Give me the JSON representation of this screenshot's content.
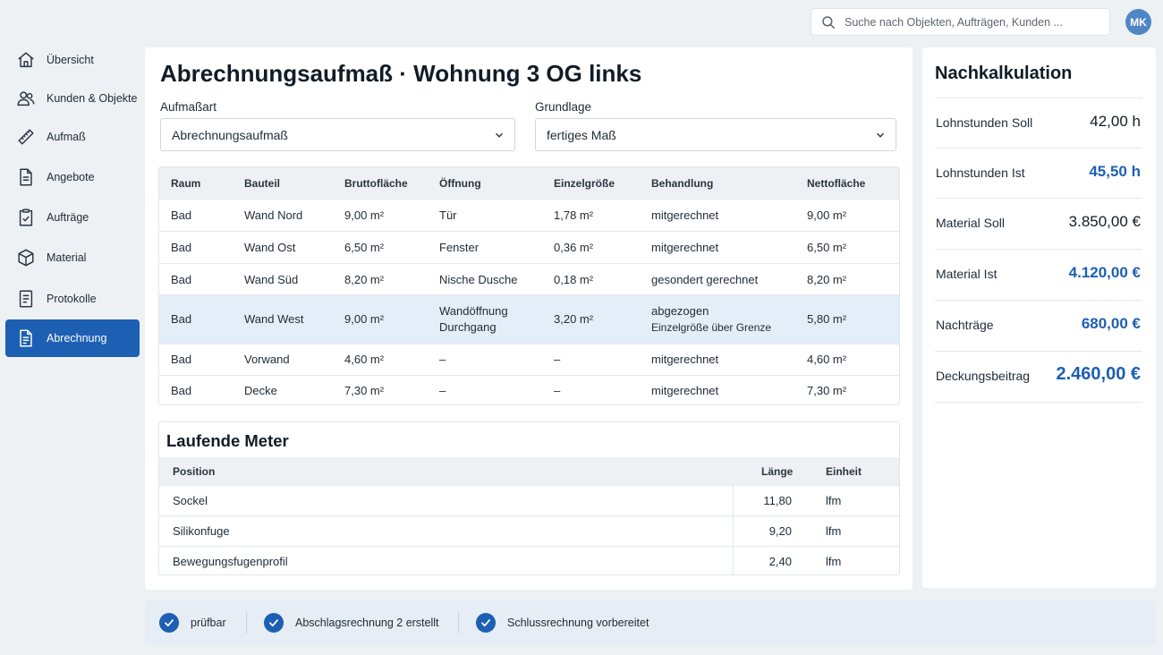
{
  "sidebar": {
    "items": [
      {
        "label": "Übersicht",
        "icon": "home-icon",
        "active": false
      },
      {
        "label": "Kunden & Objekte",
        "icon": "users-icon",
        "active": false
      },
      {
        "label": "Aufmaß",
        "icon": "ruler-icon",
        "active": false
      },
      {
        "label": "Angebote",
        "icon": "document-icon",
        "active": false
      },
      {
        "label": "Aufträge",
        "icon": "clipboard-check-icon",
        "active": false
      },
      {
        "label": "Material",
        "icon": "box-icon",
        "active": false
      },
      {
        "label": "Protokolle",
        "icon": "list-document-icon",
        "active": false
      },
      {
        "label": "Abrechnung",
        "icon": "invoice-icon",
        "active": true
      }
    ]
  },
  "header": {
    "search_placeholder": "Suche nach Objekten, Aufträgen, Kunden ...",
    "avatar_initials": "MK"
  },
  "main": {
    "title": "Abrechnungsaufmaß · Wohnung 3 OG links",
    "aufmassart": {
      "label": "Aufmaßart",
      "value": "Abrechnungsaufmaß"
    },
    "grundlage": {
      "label": "Grundlage",
      "value": "fertiges Maß"
    },
    "table": {
      "columns": [
        "Raum",
        "Bauteil",
        "Bruttofläche",
        "Öffnung",
        "Einzelgröße",
        "Behandlung",
        "Nettofläche"
      ],
      "rows": [
        {
          "raum": "Bad",
          "bauteil": "Wand Nord",
          "brutto": "9,00 m²",
          "oeffnung": "Tür",
          "oeffnung2": "",
          "einzel": "1,78 m²",
          "behandlung": "mitgerechnet",
          "behandlung2": "",
          "netto": "9,00 m²",
          "highlight": false
        },
        {
          "raum": "Bad",
          "bauteil": "Wand Ost",
          "brutto": "6,50 m²",
          "oeffnung": "Fenster",
          "oeffnung2": "",
          "einzel": "0,36 m²",
          "behandlung": "mitgerechnet",
          "behandlung2": "",
          "netto": "6,50 m²",
          "highlight": false
        },
        {
          "raum": "Bad",
          "bauteil": "Wand Süd",
          "brutto": "8,20 m²",
          "oeffnung": "Nische Dusche",
          "oeffnung2": "",
          "einzel": "0,18 m²",
          "behandlung": "gesondert gerechnet",
          "behandlung2": "",
          "netto": "8,20 m²",
          "highlight": false
        },
        {
          "raum": "Bad",
          "bauteil": "Wand West",
          "brutto": "9,00 m²",
          "oeffnung": "Wandöffnung",
          "oeffnung2": "Durchgang",
          "einzel": "3,20 m²",
          "behandlung": "abgezogen",
          "behandlung2": "Einzelgröße über Grenze",
          "netto": "5,80 m²",
          "highlight": true
        },
        {
          "raum": "Bad",
          "bauteil": "Vorwand",
          "brutto": "4,60 m²",
          "oeffnung": "–",
          "oeffnung2": "",
          "einzel": "–",
          "behandlung": "mitgerechnet",
          "behandlung2": "",
          "netto": "4,60 m²",
          "highlight": false
        },
        {
          "raum": "Bad",
          "bauteil": "Decke",
          "brutto": "7,30 m²",
          "oeffnung": "–",
          "oeffnung2": "",
          "einzel": "–",
          "behandlung": "mitgerechnet",
          "behandlung2": "",
          "netto": "7,30 m²",
          "highlight": false
        }
      ]
    },
    "laufende_meter": {
      "title": "Laufende Meter",
      "columns": [
        "Position",
        "Länge",
        "Einheit"
      ],
      "rows": [
        {
          "position": "Sockel",
          "laenge": "11,80",
          "einheit": "lfm"
        },
        {
          "position": "Silikonfuge",
          "laenge": "9,20",
          "einheit": "lfm"
        },
        {
          "position": "Bewegungsfugenprofil",
          "laenge": "2,40",
          "einheit": "lfm"
        }
      ]
    }
  },
  "kalkulation": {
    "title": "Nachkalkulation",
    "rows": [
      {
        "label": "Lohnstunden Soll",
        "value": "42,00 h",
        "blue": false,
        "big": false
      },
      {
        "label": "Lohnstunden Ist",
        "value": "45,50 h",
        "blue": true,
        "big": false
      },
      {
        "label": "Material Soll",
        "value": "3.850,00 €",
        "blue": false,
        "big": false
      },
      {
        "label": "Material Ist",
        "value": "4.120,00 €",
        "blue": true,
        "big": false
      },
      {
        "label": "Nachträge",
        "value": "680,00 €",
        "blue": true,
        "big": false
      },
      {
        "label": "Deckungsbeitrag",
        "value": "2.460,00 €",
        "blue": true,
        "big": true
      }
    ]
  },
  "status": {
    "items": [
      {
        "label": "prüfbar"
      },
      {
        "label": "Abschlagsrechnung 2 erstellt"
      },
      {
        "label": "Schlussrechnung vorbereitet"
      }
    ]
  },
  "colors": {
    "accent": "#1d5fb3",
    "highlight_row": "#e4eef9",
    "background": "#eef1f4"
  }
}
